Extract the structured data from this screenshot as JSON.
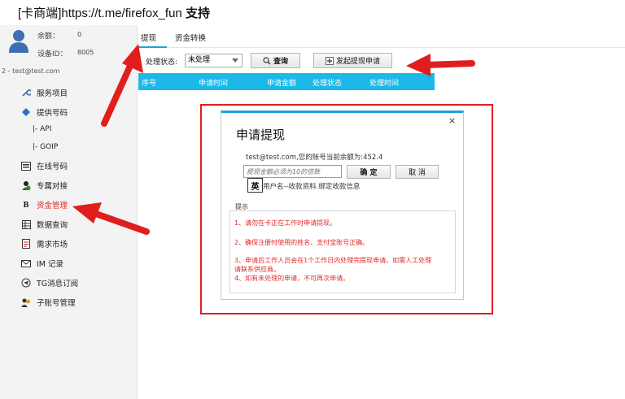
{
  "header": {
    "bracket_open": "[",
    "site_name": "卡商端",
    "bracket_close": "]",
    "url": "https://t.me/firefox_fun",
    "support": "支持"
  },
  "account": {
    "balance_label": "余额：",
    "balance_value": "0",
    "device_label": "设备ID：",
    "device_value": "8005",
    "user_line": "2 - test@test.com"
  },
  "sidebar": {
    "items": [
      {
        "label": "服务项目",
        "icon": "wrench-icon"
      },
      {
        "label": "提供号码",
        "icon": "diamond-icon"
      },
      {
        "label": "在线号码",
        "icon": "list-icon"
      },
      {
        "label": "专属对接",
        "icon": "people-icon"
      },
      {
        "label": "资金管理",
        "icon": "bold-b-icon"
      },
      {
        "label": "数据查询",
        "icon": "grid-icon"
      },
      {
        "label": "需求市场",
        "icon": "document-icon"
      },
      {
        "label": "IM 记录",
        "icon": "mail-icon"
      },
      {
        "label": "TG消息订阅",
        "icon": "telegram-icon"
      },
      {
        "label": "子账号管理",
        "icon": "users-icon"
      }
    ],
    "subitems": [
      "|-  API",
      "|-  GOIP"
    ],
    "active_color": "#e02a2a"
  },
  "tabs": [
    {
      "label": "提现"
    },
    {
      "label": "资金转换"
    }
  ],
  "filter": {
    "status_label": "处理状态:",
    "status_value": "未处理",
    "query_label": "查询",
    "withdraw_label": "发起提现申请"
  },
  "table": {
    "columns": [
      "序号",
      "申请时间",
      "申请金额",
      "处理状态",
      "处理时间"
    ],
    "header_color": "#1bb8e8"
  },
  "dialog": {
    "title": "申请提现",
    "close": "×",
    "info": "test@test.com,您的账号当前余额为:452.4",
    "amount_placeholder": "提现金额必须为10的倍数",
    "confirm_label": "确 定",
    "cancel_label": "取 消",
    "ime_badge": "英",
    "bind_hint": "用户名--收款资料.绑定收款信息",
    "tips_label": "提示",
    "tips": [
      "1、请勿在卡正在工作时申请提现。",
      "2、确保注册时使用的姓名、支付宝账号正确。",
      "3、申请后工作人员会在1个工作日内处理完提现申请。如需人工处理",
      "请联系供应商。",
      "4、如有未处理的申请，不可再次申请。"
    ]
  }
}
